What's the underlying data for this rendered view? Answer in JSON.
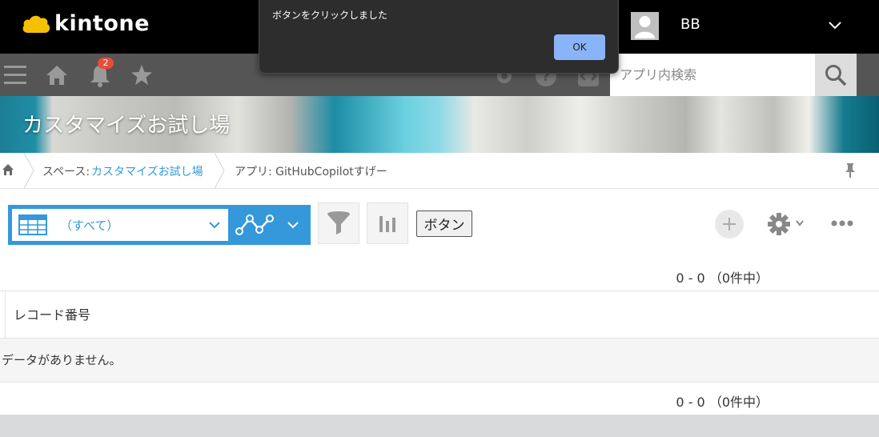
{
  "header": {
    "logo_text": "kintone",
    "user_name": "BB",
    "notification_count": "2"
  },
  "navbar": {
    "search_placeholder": "アプリ内検索"
  },
  "banner": {
    "title": "カスタマイズお試し場"
  },
  "breadcrumb": {
    "space_prefix": "スペース:",
    "space_name": "カスタマイズお試し場",
    "app_label": "アプリ: GitHubCopilotすげー"
  },
  "toolbar": {
    "view_name": "（すべて）",
    "custom_button_label": "ボタン"
  },
  "records": {
    "count_text": "0 - 0 （0件中）",
    "column_header": "レコード番号",
    "empty_message": "データがありません。"
  },
  "dialog": {
    "message": "ボタンをクリックしました",
    "ok_label": "OK"
  },
  "colors": {
    "accent": "#3498db",
    "topbar": "#000000",
    "navbar": "#555555",
    "dialog_bg": "#2d2d2d",
    "dialog_button": "#8ab4f8"
  }
}
